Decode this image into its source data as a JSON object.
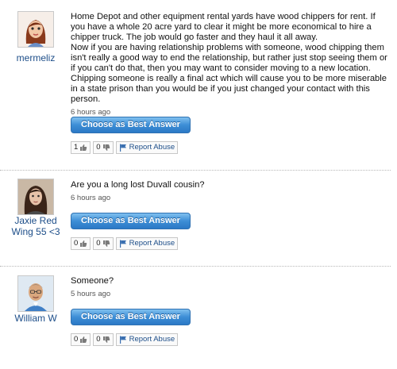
{
  "answers": [
    {
      "username": "mermeliz",
      "text": "Home Depot and other equipment rental yards have wood chippers for rent. If you have a whole 20 acre yard to clear it might be more economical to hire a chipper truck. The job would go faster and they haul it all away.\nNow if you are having relationship problems with someone, wood chipping them isn't really a good way to end the relationship, but rather just stop seeing them or if you can't do that, then you may want to consider moving to a new location. Chipping someone is really a final act which will cause you to be more miserable in a state prison than you would be if you just changed your contact with this person.",
      "time": "6 hours ago",
      "best_label": "Choose as Best Answer",
      "thumbs_up": "1",
      "thumbs_down": "0",
      "report_label": "Report Abuse"
    },
    {
      "username": "Jaxie Red Wing 55 <3",
      "text": "Are you a long lost Duvall cousin?",
      "time": "6 hours ago",
      "best_label": "Choose as Best Answer",
      "thumbs_up": "0",
      "thumbs_down": "0",
      "report_label": "Report Abuse"
    },
    {
      "username": "William W",
      "text": "Someone?",
      "time": "5 hours ago",
      "best_label": "Choose as Best Answer",
      "thumbs_up": "0",
      "thumbs_down": "0",
      "report_label": "Report Abuse"
    }
  ]
}
